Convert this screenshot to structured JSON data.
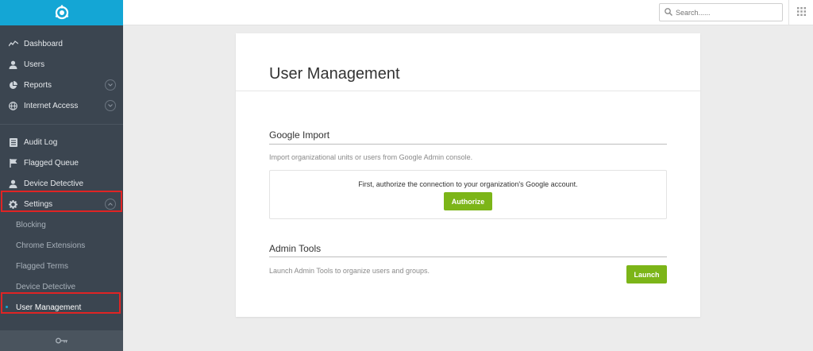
{
  "sidebar": {
    "primary": [
      {
        "label": "Dashboard",
        "icon": "chart-line-icon"
      },
      {
        "label": "Users",
        "icon": "user-icon"
      },
      {
        "label": "Reports",
        "icon": "pie-chart-icon",
        "expandable": true
      },
      {
        "label": "Internet Access",
        "icon": "globe-icon",
        "expandable": true
      }
    ],
    "secondary": [
      {
        "label": "Audit Log",
        "icon": "list-icon"
      },
      {
        "label": "Flagged Queue",
        "icon": "flag-icon"
      },
      {
        "label": "Device Detective",
        "icon": "user-icon"
      },
      {
        "label": "Settings",
        "icon": "gear-icon",
        "expanded": true
      }
    ],
    "settings_sub": [
      {
        "label": "Blocking"
      },
      {
        "label": "Chrome Extensions"
      },
      {
        "label": "Flagged Terms"
      },
      {
        "label": "Device Detective"
      },
      {
        "label": "User Management",
        "active": true
      }
    ]
  },
  "topbar": {
    "search_placeholder": "Search......"
  },
  "main": {
    "title": "User Management",
    "google_import": {
      "title": "Google Import",
      "description": "Import organizational units or users from Google Admin console.",
      "auth_text": "First, authorize the connection to your organization's Google account.",
      "button": "Authorize"
    },
    "admin_tools": {
      "title": "Admin Tools",
      "description": "Launch Admin Tools to organize users and groups.",
      "button": "Launch"
    }
  },
  "colors": {
    "brand": "#14a6d5",
    "sidebar": "#3b4550",
    "button": "#7cb518",
    "highlight": "#e02424"
  }
}
